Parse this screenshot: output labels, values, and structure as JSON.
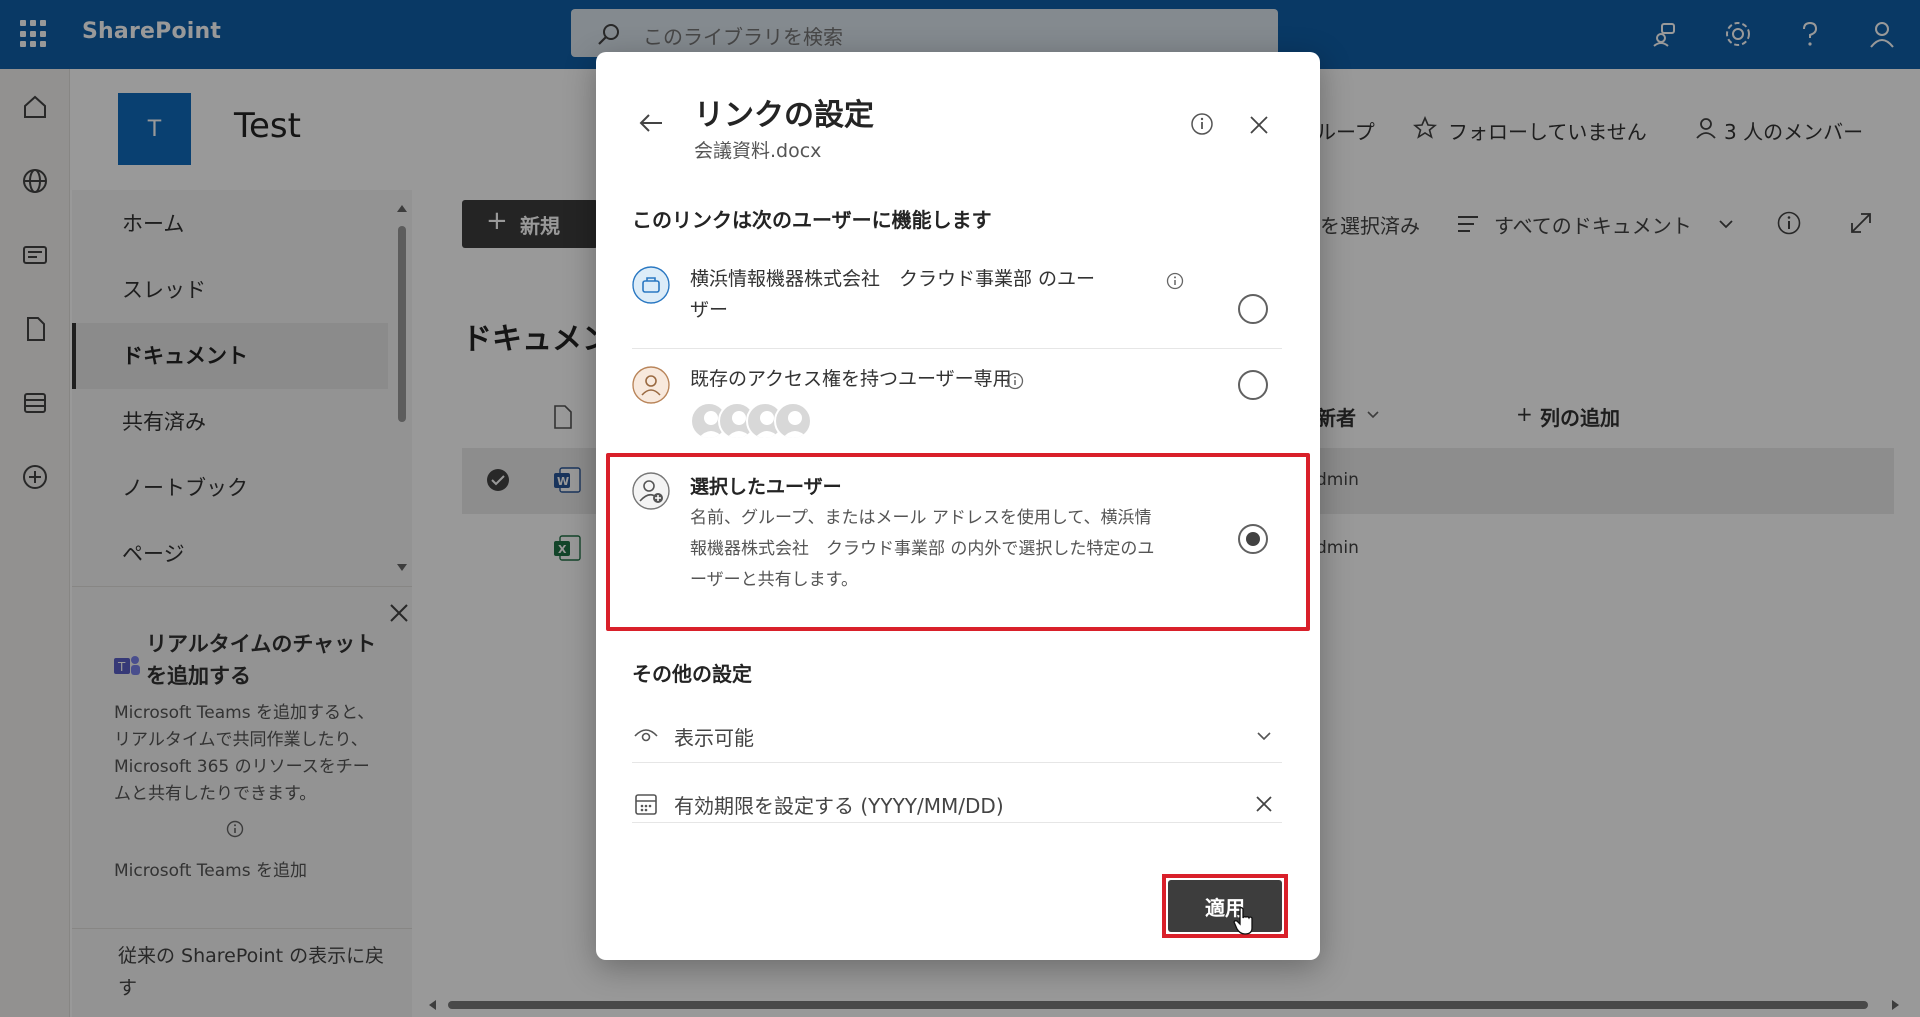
{
  "suitebar": {
    "app_name": "SharePoint",
    "search_placeholder": "このライブラリを検索"
  },
  "site": {
    "logo_letter": "T",
    "title": "Test",
    "group_label": "ループ",
    "follow_label": "フォローしていません",
    "members_label": "3 人のメンバー"
  },
  "nav": {
    "items": [
      {
        "label": "ホーム"
      },
      {
        "label": "スレッド"
      },
      {
        "label": "ドキュメント"
      },
      {
        "label": "共有済み"
      },
      {
        "label": "ノートブック"
      },
      {
        "label": "ページ"
      }
    ],
    "teams_title": "リアルタイムのチャットを追加する",
    "teams_desc": "Microsoft Teams を追加すると、リアルタイムで共同作業したり、Microsoft 365 のリソースをチームと共有したりできます。",
    "teams_link": "Microsoft Teams を追加",
    "classic_link": "従来の SharePoint の表示に戻す"
  },
  "commandbar": {
    "new_label": "新規",
    "selected_label": "を選択済み",
    "view_label": "すべてのドキュメント"
  },
  "library": {
    "title": "ドキュメン",
    "col_modified_by": "新者",
    "col_add": "列の追加",
    "rows": [
      {
        "modified_by": "dmin"
      },
      {
        "modified_by": "dmin"
      }
    ]
  },
  "dialog": {
    "title": "リンクの設定",
    "filename": "会議資料.docx",
    "section_label": "このリンクは次のユーザーに機能します",
    "options": [
      {
        "label": "横浜情報機器株式会社　クラウド事業部 のユー",
        "label2": "ザー"
      },
      {
        "label": "既存のアクセス権を持つユーザー専用"
      },
      {
        "label": "選択したユーザー",
        "desc1": "名前、グループ、またはメール アドレスを使用して、横浜情",
        "desc2": "報機器株式会社　クラウド事業部 の内外で選択した特定のユ",
        "desc3": "ーザーと共有します。"
      }
    ],
    "selected_option": 2,
    "other_label": "その他の設定",
    "permission": "表示可能",
    "expiry_placeholder": "有効期限を設定する (YYYY/MM/DD)",
    "apply_label": "適用"
  },
  "colors": {
    "suitebar": "#0f5fa8",
    "accent": "#0f6cbd",
    "highlight": "#d9202a",
    "primary_button": "#3d3d3d"
  }
}
